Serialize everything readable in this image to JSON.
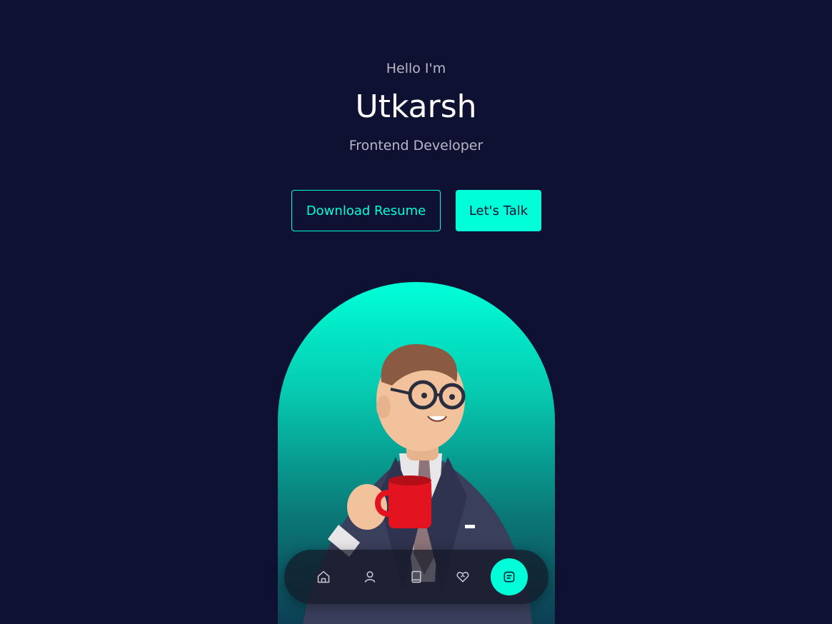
{
  "hero": {
    "greeting": "Hello I'm",
    "name": "Utkarsh",
    "role": "Frontend Developer"
  },
  "buttons": {
    "download_resume": "Download Resume",
    "lets_talk": "Let's Talk"
  },
  "nav": {
    "items": [
      {
        "icon": "home-icon",
        "active": false
      },
      {
        "icon": "user-icon",
        "active": false
      },
      {
        "icon": "book-icon",
        "active": false
      },
      {
        "icon": "handshake-icon",
        "active": false
      },
      {
        "icon": "message-icon",
        "active": true
      }
    ]
  },
  "colors": {
    "background": "#0f1132",
    "accent": "#00ffd8",
    "muted_text": "#b7b8c7"
  }
}
